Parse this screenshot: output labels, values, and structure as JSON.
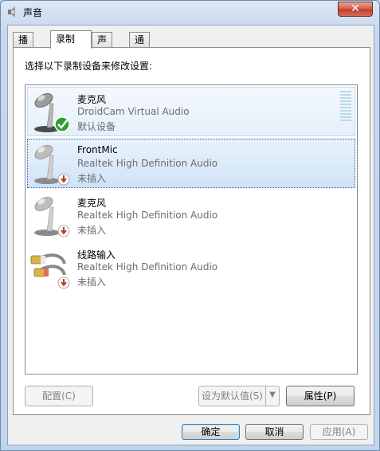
{
  "window": {
    "title": "声音",
    "close_label": "✕"
  },
  "tabs": [
    {
      "label": "播放",
      "active": false
    },
    {
      "label": "录制",
      "active": true
    },
    {
      "label": "声音",
      "active": false
    },
    {
      "label": "通信",
      "active": false
    }
  ],
  "instruction": "选择以下录制设备来修改设置:",
  "devices": [
    {
      "name": "麦克风",
      "driver": "DroidCam Virtual Audio",
      "status": "默认设备",
      "icon": "microphone-icon",
      "badge": "check-icon",
      "state": "hover"
    },
    {
      "name": "FrontMic",
      "driver": "Realtek High Definition Audio",
      "status": "未插入",
      "icon": "microphone-icon",
      "badge": "unplugged-icon",
      "state": "selected"
    },
    {
      "name": "麦克风",
      "driver": "Realtek High Definition Audio",
      "status": "未插入",
      "icon": "microphone-icon",
      "badge": "unplugged-icon",
      "state": "normal"
    },
    {
      "name": "线路输入",
      "driver": "Realtek High Definition Audio",
      "status": "未插入",
      "icon": "line-in-cable-icon",
      "badge": "unplugged-icon",
      "state": "normal"
    }
  ],
  "panel_buttons": {
    "configure": "配置(C)",
    "set_default": "设为默认值(S)",
    "properties": "属性(P)"
  },
  "dialog_buttons": {
    "ok": "确定",
    "cancel": "取消",
    "apply": "应用(A)"
  },
  "colors": {
    "accent_selected": "#cfe3f8",
    "check_green": "#2f9e2f",
    "unplugged_red": "#c0392b"
  }
}
